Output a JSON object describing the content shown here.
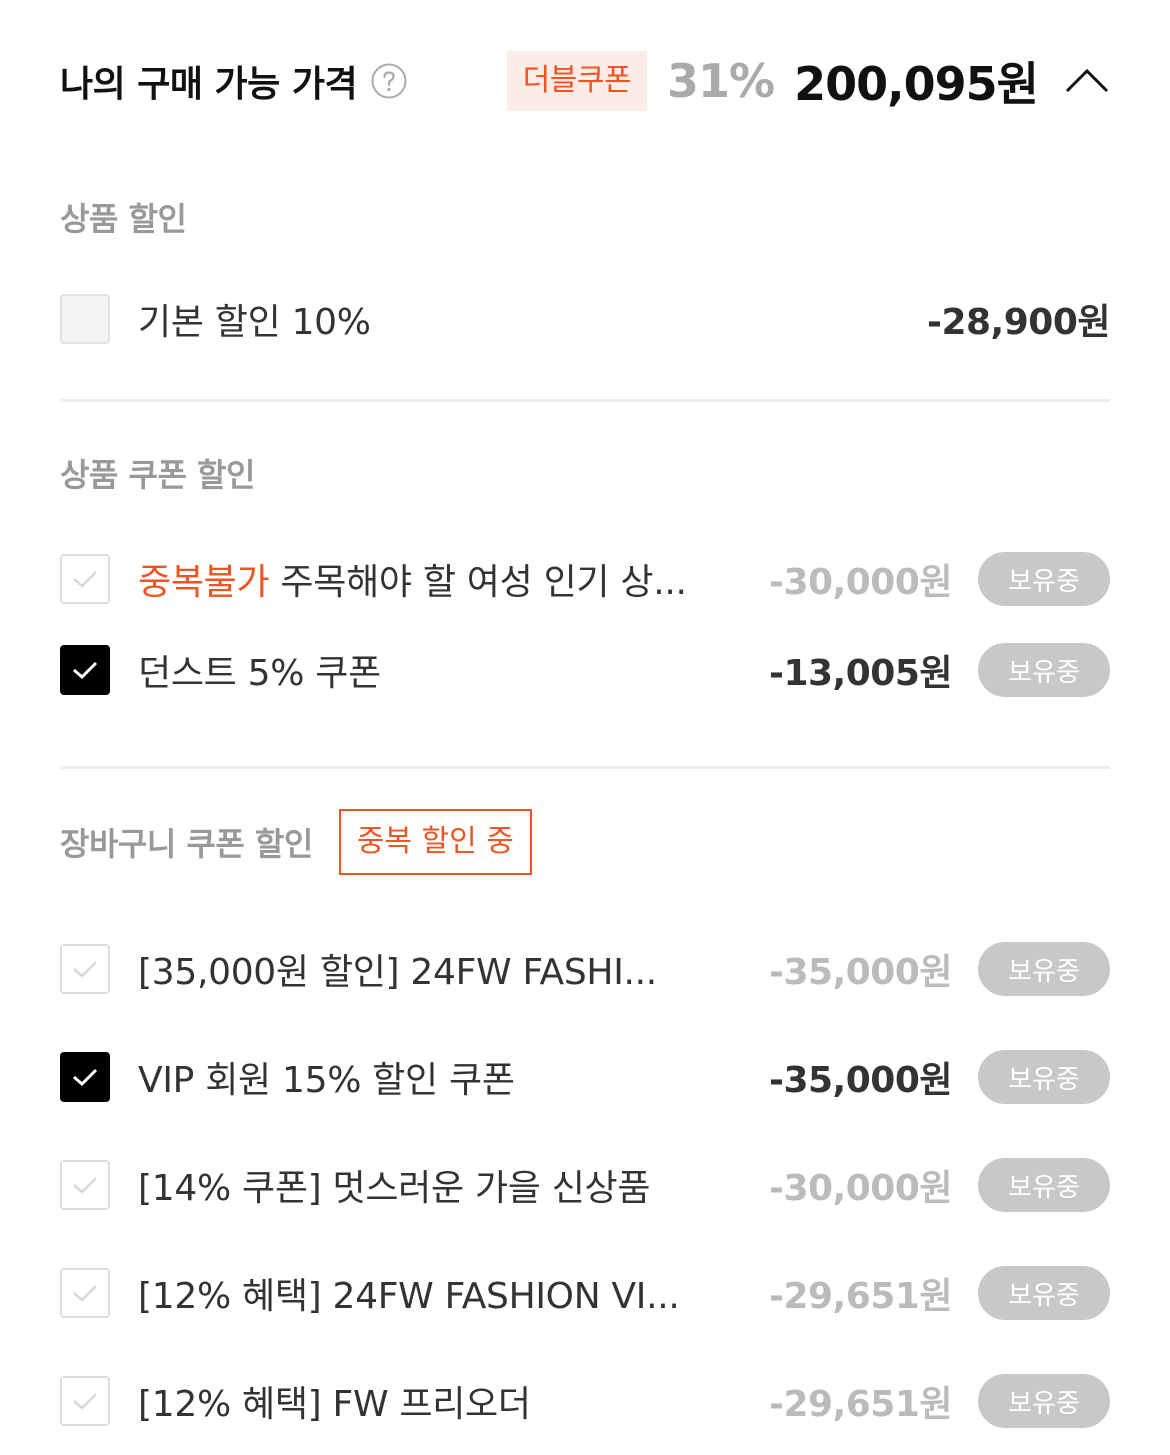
{
  "header": {
    "title": "나의 구매 가능 가격",
    "double_coupon_badge": "더블쿠폰",
    "discount_rate": "31%",
    "final_price": "200,095원"
  },
  "product_discount": {
    "title": "상품 할인",
    "items": [
      {
        "label": "기본 할인 10%",
        "amount": "-28,900원"
      }
    ]
  },
  "product_coupon": {
    "title": "상품 쿠폰 할인",
    "items": [
      {
        "tag": "중복불가",
        "label": " 주목해야 할 여성 인기 상...",
        "amount": "-30,000원",
        "status": "보유중",
        "checked": false
      },
      {
        "label": "던스트 5% 쿠폰",
        "amount": "-13,005원",
        "status": "보유중",
        "checked": true
      }
    ]
  },
  "cart_coupon": {
    "title": "장바구니 쿠폰 할인",
    "badge": "중복 할인 중",
    "items": [
      {
        "label": "[35,000원 할인] 24FW FASHI...",
        "amount": "-35,000원",
        "status": "보유중",
        "checked": false
      },
      {
        "label": "VIP 회원 15% 할인 쿠폰",
        "amount": "-35,000원",
        "status": "보유중",
        "checked": true
      },
      {
        "label": "[14% 쿠폰] 멋스러운 가을 신상품",
        "amount": "-30,000원",
        "status": "보유중",
        "checked": false
      },
      {
        "label": "[12% 혜택] 24FW FASHION VI...",
        "amount": "-29,651원",
        "status": "보유중",
        "checked": false
      },
      {
        "label": "[12% 혜택] FW 프리오더",
        "amount": "-29,651원",
        "status": "보유중",
        "checked": false
      }
    ]
  },
  "colors": {
    "accent": "#f05423",
    "checked": "#000000",
    "muted": "#999999",
    "pill": "#c8c8c8"
  }
}
